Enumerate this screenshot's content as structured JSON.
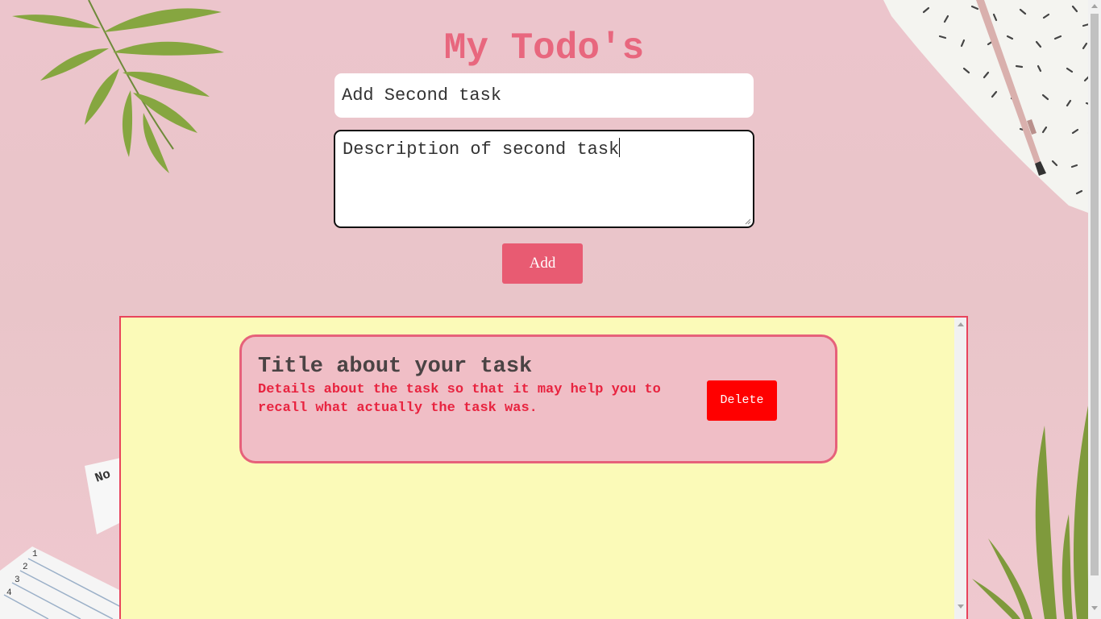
{
  "app": {
    "title": "My Todo's"
  },
  "form": {
    "title_value": "Add Second task",
    "description_value": "Description of second task",
    "add_label": "Add"
  },
  "todos": [
    {
      "title": "Title about your task",
      "description": "Details about the task so that it may help you to recall what actually the task was.",
      "delete_label": "Delete"
    }
  ],
  "colors": {
    "accent": "#e85b72",
    "title": "#e8677e",
    "list_background": "#fbfab8",
    "card_background": "#f0bec6",
    "delete": "#ff0000"
  },
  "icons": {
    "decorations": [
      "palm-leaf-icon",
      "notebook-icon",
      "pen-icon",
      "notepad-icon"
    ]
  }
}
